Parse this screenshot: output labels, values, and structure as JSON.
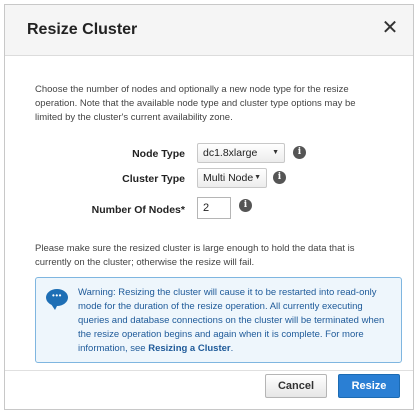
{
  "dialog": {
    "title": "Resize Cluster",
    "close_symbol": "✕"
  },
  "intro": "Choose the number of nodes and optionally a new node type for the resize operation. Note that the available node type and cluster type options may be limited by the cluster's current availability zone.",
  "form": {
    "node_type": {
      "label": "Node Type",
      "value": "dc1.8xlarge",
      "icon": "info-icon"
    },
    "cluster_type": {
      "label": "Cluster Type",
      "value": "Multi Node",
      "icon": "info-icon"
    },
    "number_of_nodes": {
      "label": "Number Of Nodes*",
      "value": "2",
      "icon": "info-icon"
    }
  },
  "note": "Please make sure the resized cluster is large enough to hold the data that is currently on the cluster; otherwise the resize will fail.",
  "warning": {
    "icon": "speech-bubble-icon",
    "text": "Warning: Resizing the cluster will cause it to be restarted into read-only mode for the duration of the resize operation. All currently executing queries and database connections on the cluster will be terminated when the resize operation begins and again when it is complete. For more information, see ",
    "link": "Resizing a Cluster",
    "suffix": "."
  },
  "buttons": {
    "cancel": "Cancel",
    "resize": "Resize"
  },
  "colors": {
    "primary": "#2a7fd4",
    "warning_bg": "#eef6fc",
    "warning_border": "#7fb6e0",
    "warning_text": "#1e5a99"
  }
}
